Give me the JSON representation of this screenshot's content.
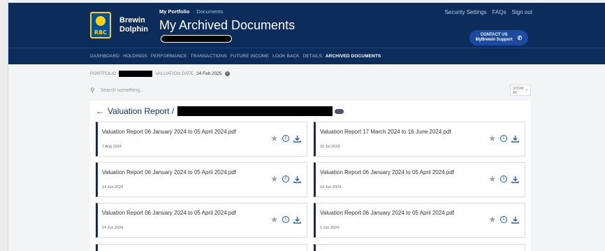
{
  "header": {
    "brand": [
      "Brewin",
      "Dolphin"
    ],
    "logo_text": "RBC",
    "top_tabs": [
      {
        "label": "My Portfolio",
        "active": true
      },
      {
        "label": "Documents",
        "active": false
      }
    ],
    "title": "My Archived Documents",
    "util_links": [
      "Security Settings",
      "FAQs",
      "Sign out"
    ],
    "contact": {
      "line1": "CONTACT US",
      "line2": "MyBrewin Support"
    }
  },
  "nav": {
    "items": [
      "DASHBOARD",
      "HOLDINGS",
      "PERFORMANCE",
      "TRANSACTIONS",
      "FUTURE INCOME",
      "LOOK BACK",
      "DETAILS",
      "ARCHIVED DOCUMENTS"
    ],
    "active_index": 7
  },
  "portfolio": {
    "label": "PORTFOLIO",
    "valuation_label": "VALUATION DATE",
    "valuation_date": "24 Feb 2025"
  },
  "search": {
    "placeholder": "Search something..."
  },
  "show": {
    "label": "SHOW",
    "value": "All"
  },
  "breadcrumb": {
    "label": "Valuation Report /"
  },
  "documents": [
    {
      "title": "Valuation Report 06 January 2024 to 05 April 2024.pdf",
      "date": "7 Aug 2024"
    },
    {
      "title": "Valuation Report 17 March 2024 to 16 June 2024.pdf",
      "date": "10 Jul 2024"
    },
    {
      "title": "Valuation Report 06 January 2024 to 05 April 2024.pdf",
      "date": "14 Jun 2024"
    },
    {
      "title": "Valuation Report 06 January 2024 to 05 April 2024.pdf",
      "date": "14 Jun 2024"
    },
    {
      "title": "Valuation Report 06 January 2024 to 05 April 2024.pdf",
      "date": "14 Jun 2024"
    },
    {
      "title": "Valuation Report 06 January 2024 to 05 April 2024.pdf",
      "date": "1 Jun 2024"
    }
  ],
  "colors": {
    "header_bg": "#0c2d5b",
    "accent": "#1a5bb5",
    "panel_bg": "#ffffff"
  }
}
